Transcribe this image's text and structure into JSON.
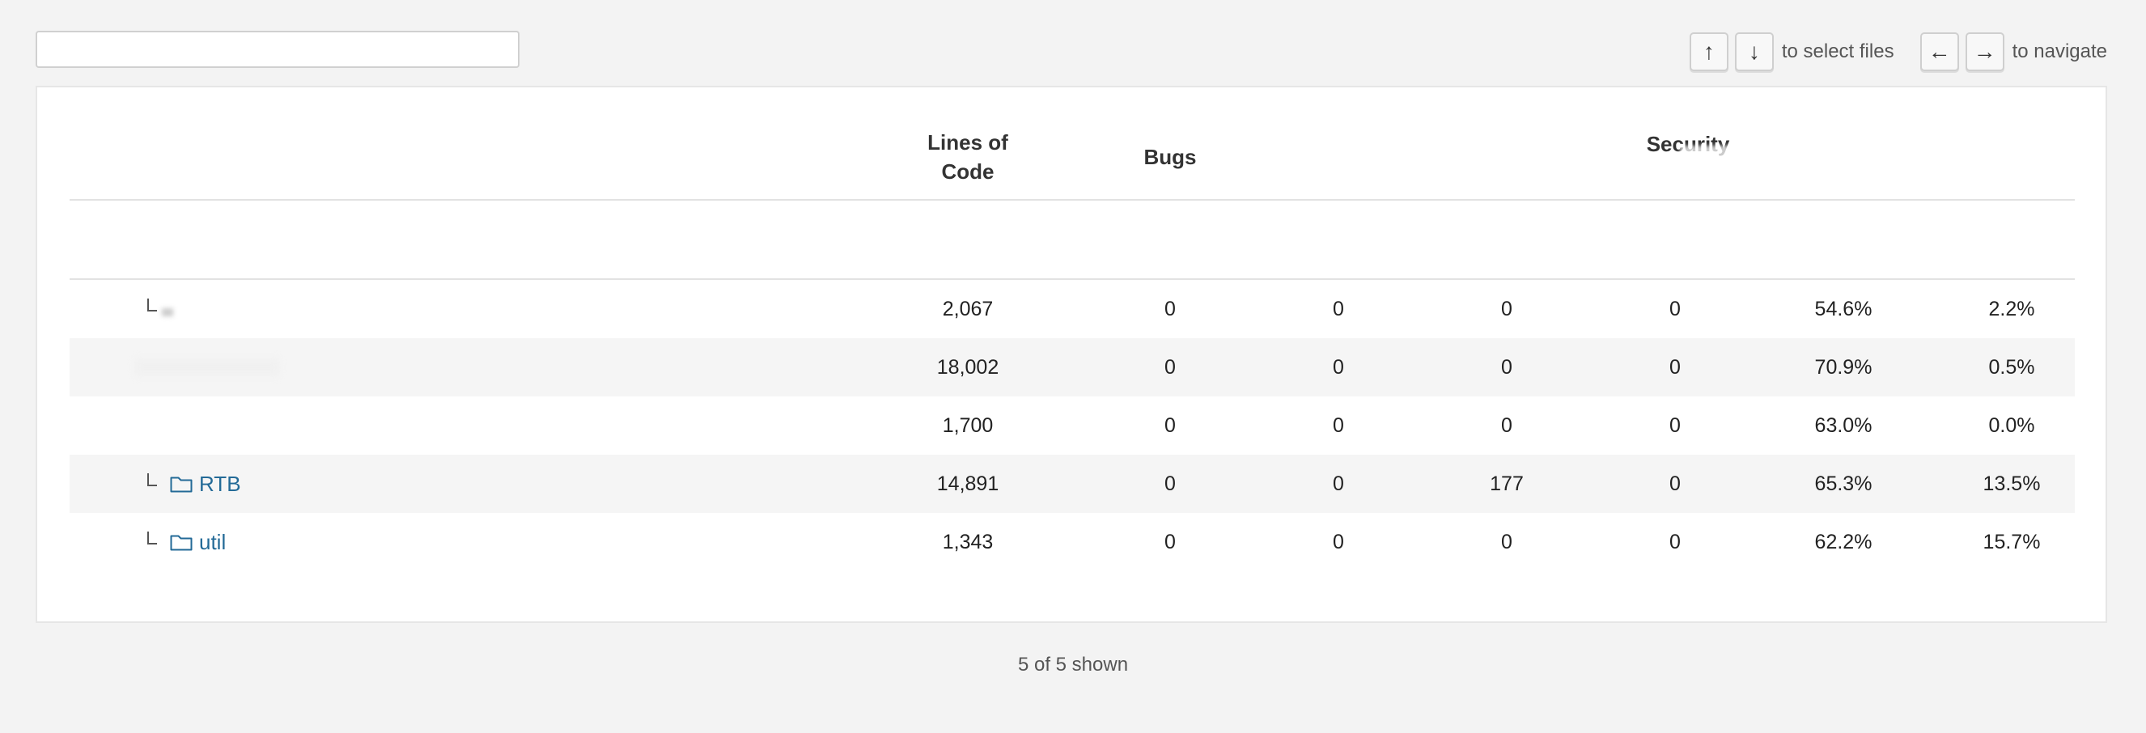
{
  "search": {
    "value": "",
    "placeholder": ""
  },
  "shortcuts": {
    "up_key": "↑",
    "down_key": "↓",
    "select_text": "to select files",
    "left_key": "←",
    "right_key": "→",
    "navigate_text": "to navigate"
  },
  "table": {
    "headers": {
      "lines_of_code": "Lines of Code",
      "bugs": "Bugs",
      "security": "Security"
    },
    "rows": [
      {
        "name": "",
        "is_folder": false,
        "lines_of_code": "2,067",
        "bugs": "0",
        "vulnerabilities": "0",
        "code_smells": "0",
        "hotspots": "0",
        "coverage": "54.6%",
        "duplications": "2.2%"
      },
      {
        "name": "",
        "is_folder": false,
        "lines_of_code": "18,002",
        "bugs": "0",
        "vulnerabilities": "0",
        "code_smells": "0",
        "hotspots": "0",
        "coverage": "70.9%",
        "duplications": "0.5%"
      },
      {
        "name": "",
        "is_folder": false,
        "lines_of_code": "1,700",
        "bugs": "0",
        "vulnerabilities": "0",
        "code_smells": "0",
        "hotspots": "0",
        "coverage": "63.0%",
        "duplications": "0.0%"
      },
      {
        "name": "RTB",
        "is_folder": true,
        "lines_of_code": "14,891",
        "bugs": "0",
        "vulnerabilities": "0",
        "code_smells": "177",
        "hotspots": "0",
        "coverage": "65.3%",
        "duplications": "13.5%"
      },
      {
        "name": "util",
        "is_folder": true,
        "lines_of_code": "1,343",
        "bugs": "0",
        "vulnerabilities": "0",
        "code_smells": "0",
        "hotspots": "0",
        "coverage": "62.2%",
        "duplications": "15.7%"
      }
    ]
  },
  "footer": {
    "count_text": "5 of 5 shown"
  },
  "colors": {
    "link": "#236a97",
    "background": "#f3f3f3",
    "panel": "#ffffff",
    "alt_row": "#f5f5f5"
  },
  "icons": {
    "folder": "folder-icon",
    "tree_branch": "tree-branch-icon"
  }
}
